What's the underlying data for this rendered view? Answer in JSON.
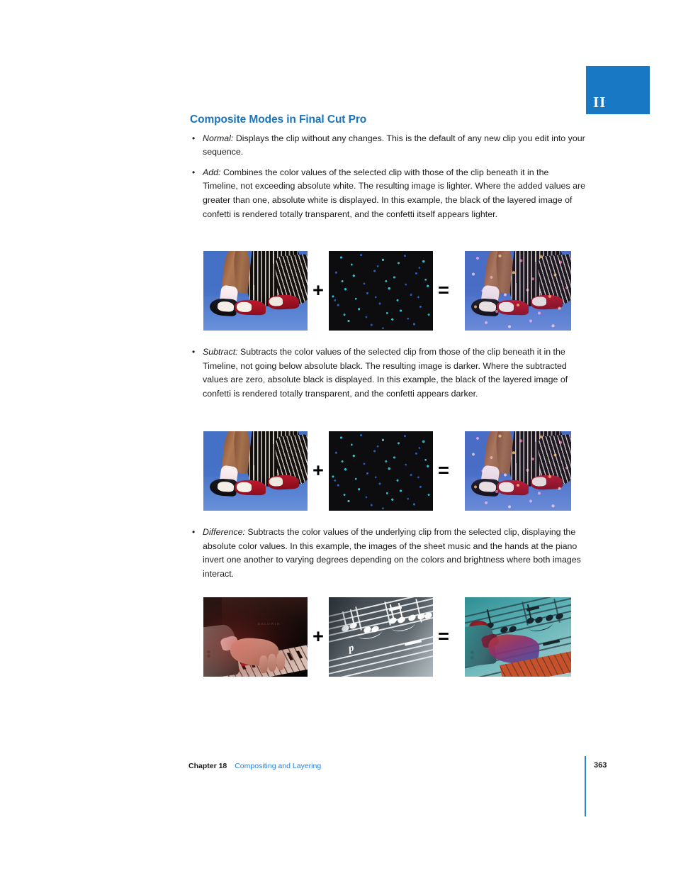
{
  "chapter_tab": {
    "numeral": "II",
    "color": "#1878c4"
  },
  "section": {
    "title": "Composite Modes in Final Cut Pro",
    "title_color": "#1b75bc"
  },
  "bullets": [
    {
      "term": "Normal:",
      "text": "Displays the clip without any changes. This is the default of any new clip you edit into your sequence."
    },
    {
      "term": "Add:",
      "text": "Combines the color values of the selected clip with those of the clip beneath it in the Timeline, not exceeding absolute white. The resulting image is lighter. Where the added values are greater than one, absolute white is displayed. In this example, the black of the layered image of confetti is rendered totally transparent, and the confetti itself appears lighter."
    },
    {
      "term": "Subtract:",
      "text": "Subtracts the color values of the selected clip from those of the clip beneath it in the Timeline, not going below absolute black. The resulting image is darker. Where the subtracted values are zero, absolute black is displayed. In this example, the black of the layered image of confetti is rendered totally transparent, and the confetti appears darker."
    },
    {
      "term": "Difference:",
      "text": "Subtracts the color values of the underlying clip from the selected clip, displaying the absolute color values. In this example, the images of the sheet music and the hands at the piano invert one another to varying degrees depending on the colors and brightness where both images interact."
    }
  ],
  "figures": [
    {
      "id": "figure-add",
      "operand_a": "dancing-feet-photo",
      "operator_1": "+",
      "operand_b": "confetti-on-black-photo",
      "operator_2": "=",
      "result": "add-composite-result-photo"
    },
    {
      "id": "figure-subtract",
      "operand_a": "dancing-feet-photo",
      "operator_1": "+",
      "operand_b": "confetti-on-black-photo",
      "operator_2": "=",
      "result": "subtract-composite-result-photo"
    },
    {
      "id": "figure-difference",
      "operand_a": "piano-hands-photo",
      "operator_1": "+",
      "operand_b": "sheet-music-photo",
      "operator_2": "=",
      "result": "difference-composite-result-photo"
    }
  ],
  "sheet_music": {
    "dynamic_marking": "p"
  },
  "piano": {
    "brand": "BALDWIN"
  },
  "footer": {
    "chapter": "Chapter 18",
    "title": "Compositing and Layering",
    "page_number": "363",
    "rule_color": "#2b7fd4"
  }
}
